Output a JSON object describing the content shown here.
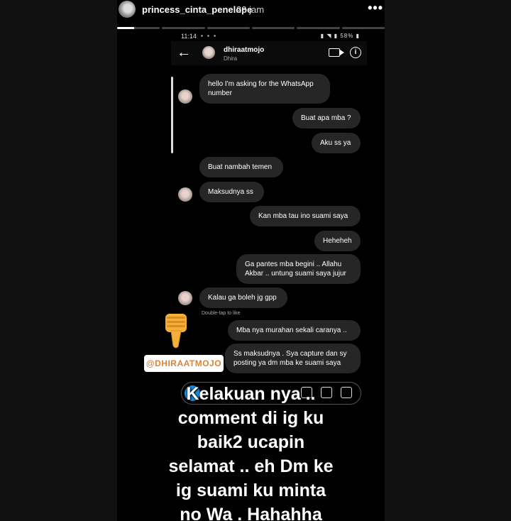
{
  "story": {
    "username": "princess_cinta_penelope",
    "time": "23 jam",
    "progress_segments": [
      1,
      0,
      0,
      0,
      0,
      0
    ]
  },
  "phone_status": {
    "time": "11:14",
    "battery": "58%"
  },
  "dm_header": {
    "name": "dhiraatmojo",
    "subtitle": "Dhira"
  },
  "messages": [
    {
      "side": "left",
      "text": "hello I'm asking for the WhatsApp number"
    },
    {
      "side": "right",
      "text": "Buat apa mba ?"
    },
    {
      "side": "right",
      "text": "Aku ss ya"
    },
    {
      "side": "left",
      "text": "Buat nambah temen"
    },
    {
      "side": "left",
      "text": "Maksudnya ss"
    },
    {
      "side": "right",
      "text": "Kan mba tau ino suami saya"
    },
    {
      "side": "right",
      "text": "Heheheh"
    },
    {
      "side": "right",
      "text": "Ga pantes mba begini .. Allahu Akbar .. untung suami saya jujur"
    },
    {
      "side": "left",
      "text": "Kalau ga boleh jg gpp"
    },
    {
      "side": "right",
      "text": "Mba nya murahan sekali caranya .."
    },
    {
      "side": "right",
      "text": "Ss maksudnya . Sya capture dan sy posting ya dm mba ke suami saya"
    }
  ],
  "double_tap_hint": "Double-tap to like",
  "mention_sticker": "@DHIRAATMOJO",
  "caption_lines": [
    "Kelakuan nya ..",
    "comment di ig ku",
    "baik2 ucapin",
    "selamat .. eh Dm ke",
    "ig suami ku minta",
    "no Wa . Hahahha"
  ],
  "icons": {
    "more": "more-dots-icon",
    "back": "back-arrow-icon",
    "video": "video-call-icon",
    "info": "info-icon",
    "thumb": "thumbs-down-icon"
  }
}
